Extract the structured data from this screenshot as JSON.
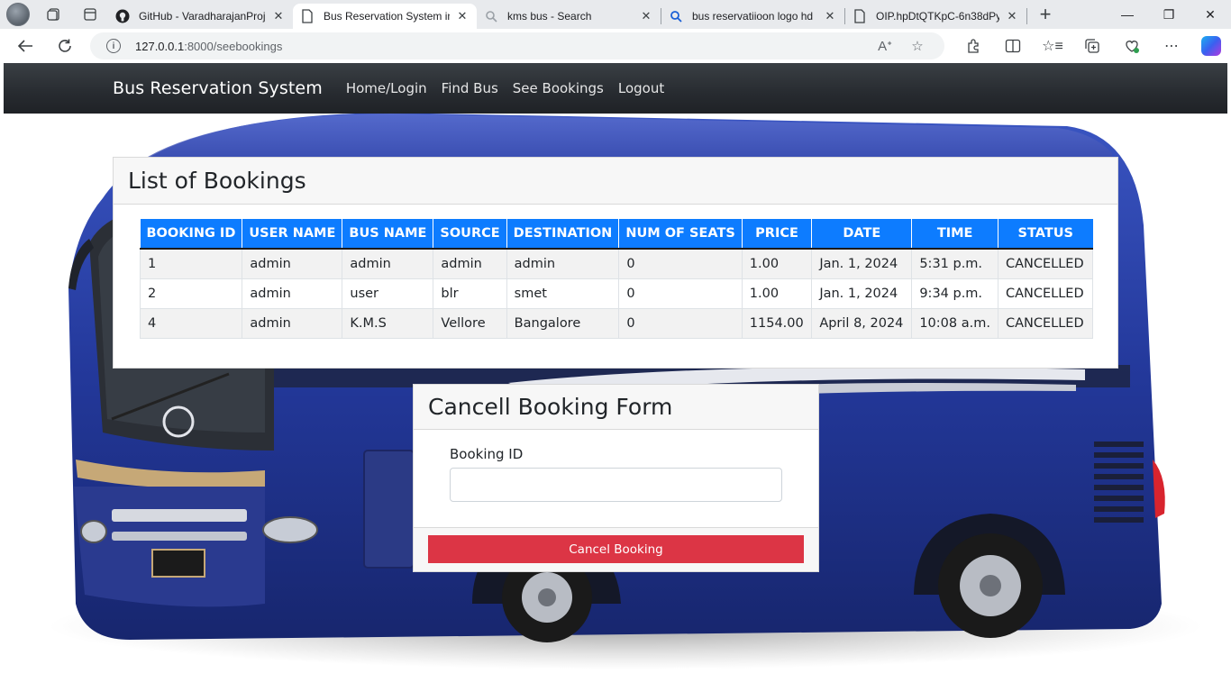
{
  "browser": {
    "tabs": [
      {
        "title": "GitHub - VaradharajanProj",
        "icon": "github-icon",
        "active": false
      },
      {
        "title": "Bus Reservation System in",
        "icon": "page-icon",
        "active": true
      },
      {
        "title": "kms bus - Search",
        "icon": "search-icon",
        "active": false
      },
      {
        "title": "bus reservatiioon logo hd",
        "icon": "search-icon",
        "active": false
      },
      {
        "title": "OIP.hpDtQTKpC-6n38dPy",
        "icon": "page-icon",
        "active": false
      }
    ],
    "url_host": "127.0.0.1",
    "url_path": ":8000/seebookings"
  },
  "navbar": {
    "brand": "Bus Reservation System",
    "links": [
      "Home/Login",
      "Find Bus",
      "See Bookings",
      "Logout"
    ]
  },
  "bookings": {
    "title": "List of Bookings",
    "columns": [
      "BOOKING ID",
      "USER NAME",
      "BUS NAME",
      "SOURCE",
      "DESTINATION",
      "NUM OF SEATS",
      "PRICE",
      "DATE",
      "TIME",
      "STATUS"
    ],
    "rows": [
      [
        "1",
        "admin",
        "admin",
        "admin",
        "admin",
        "0",
        "1.00",
        "Jan. 1, 2024",
        "5:31 p.m.",
        "CANCELLED"
      ],
      [
        "2",
        "admin",
        "user",
        "blr",
        "smet",
        "0",
        "1.00",
        "Jan. 1, 2024",
        "9:34 p.m.",
        "CANCELLED"
      ],
      [
        "4",
        "admin",
        "K.M.S",
        "Vellore",
        "Bangalore",
        "0",
        "1154.00",
        "April 8, 2024",
        "10:08 a.m.",
        "CANCELLED"
      ]
    ]
  },
  "cancel_form": {
    "title": "Cancell Booking Form",
    "field_label": "Booking ID",
    "field_value": "",
    "button_label": "Cancel Booking"
  },
  "colors": {
    "navbar": "#272b30",
    "table_header": "#0d7cff",
    "cancel_button": "#dc3545",
    "bus_body": "#2a3fa0"
  }
}
